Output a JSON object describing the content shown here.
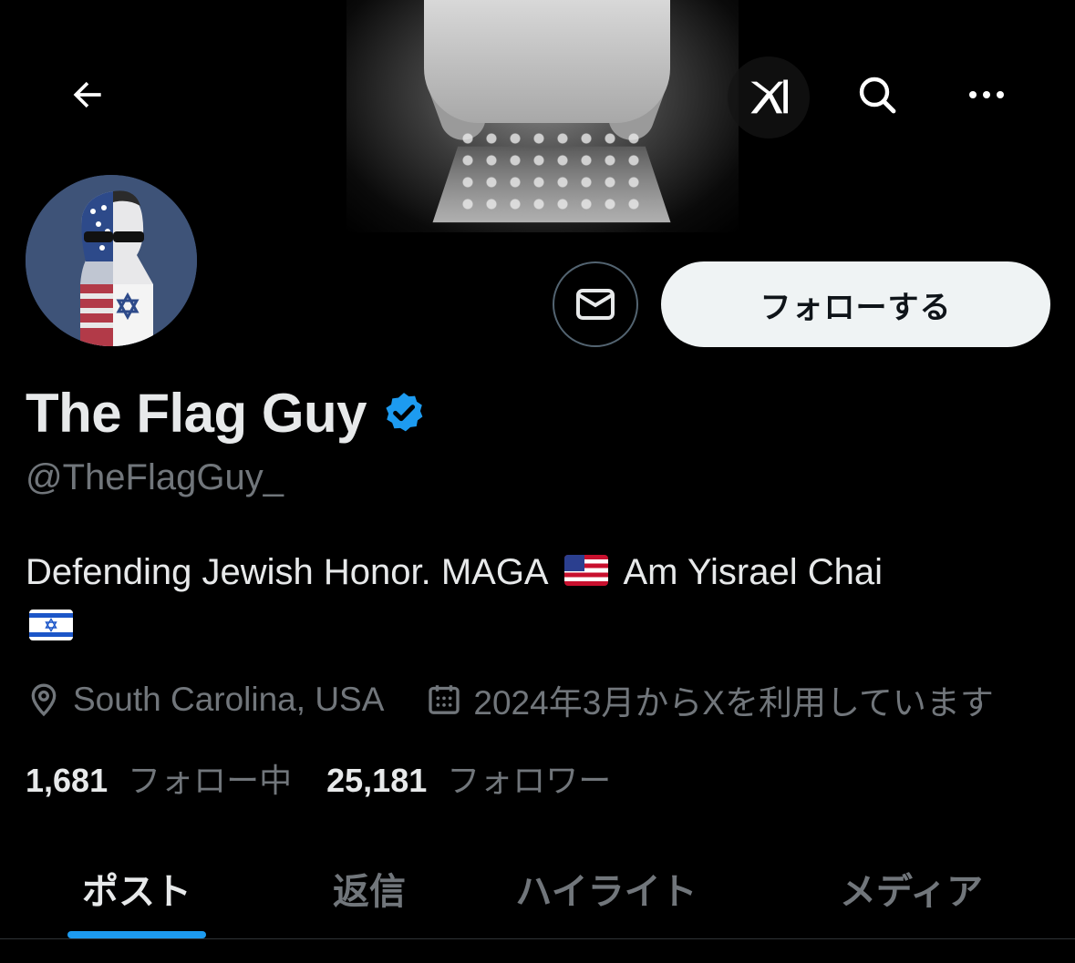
{
  "header": {
    "back_icon": "arrow-left-icon",
    "grok_icon": "grok-icon",
    "search_icon": "search-icon",
    "more_icon": "more-horizontal-icon"
  },
  "profile": {
    "display_name": "The Flag Guy",
    "handle": "@TheFlagGuy_",
    "verified": true,
    "verified_color": "#1d9bf0",
    "bio_text_1": "Defending Jewish Honor. MAGA",
    "bio_text_2": "Am Yisrael Chai",
    "location": "South Carolina, USA",
    "joined": "2024年3月からXを利用しています",
    "following_count": "1,681",
    "following_label": "フォロー中",
    "followers_count": "25,181",
    "followers_label": "フォロワー"
  },
  "actions": {
    "message_icon": "envelope-icon",
    "follow_label": "フォローする"
  },
  "tabs": [
    {
      "label": "ポスト",
      "active": true
    },
    {
      "label": "返信",
      "active": false
    },
    {
      "label": "ハイライト",
      "active": false
    },
    {
      "label": "メディア",
      "active": false
    }
  ],
  "colors": {
    "background": "#000000",
    "primary_text": "#e7e9ea",
    "secondary_text": "#71767b",
    "accent": "#1d9bf0",
    "follow_button_bg": "#eff3f4"
  }
}
